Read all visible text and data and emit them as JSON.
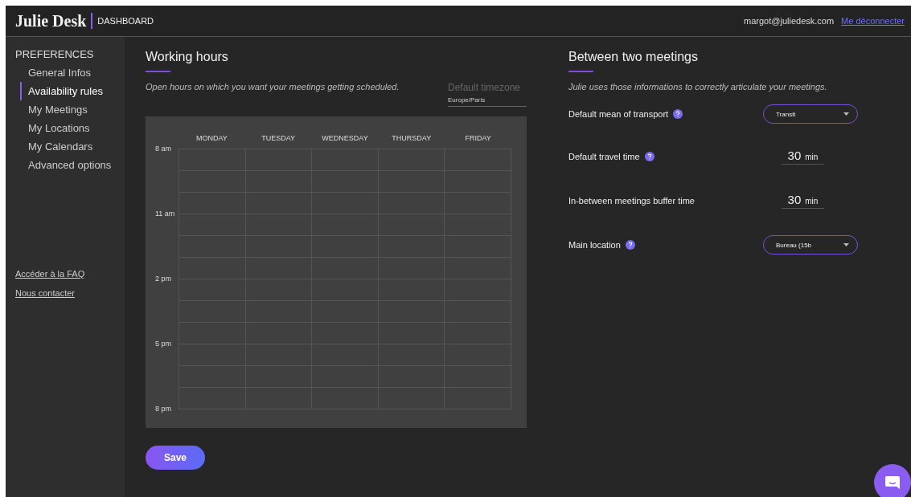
{
  "header": {
    "logo": "Julie Desk",
    "section": "DASHBOARD",
    "email": "margot@juliedesk.com",
    "logout": "Me déconnecter"
  },
  "sidebar": {
    "title": "PREFERENCES",
    "items": [
      {
        "label": "General Infos",
        "selected": false
      },
      {
        "label": "Availability rules",
        "selected": true
      },
      {
        "label": "My Meetings",
        "selected": false
      },
      {
        "label": "My Locations",
        "selected": false
      },
      {
        "label": "My Calendars",
        "selected": false
      },
      {
        "label": "Advanced options",
        "selected": false
      }
    ],
    "links": [
      "Accéder à la FAQ",
      "Nous contacter"
    ]
  },
  "working_hours": {
    "title": "Working hours",
    "description": "Open hours on which you want your meetings getting scheduled.",
    "timezone": {
      "label": "Default timezone",
      "value": "Europe/Paris"
    },
    "days": [
      "MONDAY",
      "TUESDAY",
      "WEDNESDAY",
      "THURSDAY",
      "FRIDAY"
    ],
    "time_labels": [
      "8 am",
      "11 am",
      "2 pm",
      "5 pm",
      "8 pm"
    ],
    "save": "Save"
  },
  "between_meetings": {
    "title": "Between two meetings",
    "description": "Julie uses those informations to correctly articulate your meetings.",
    "settings": [
      {
        "kind": "select",
        "label": "Default mean of transport",
        "help": true,
        "value": "Transit"
      },
      {
        "kind": "number",
        "label": "Default travel time",
        "help": true,
        "value": "30",
        "unit": "min"
      },
      {
        "kind": "number",
        "label": "In-between meetings buffer time",
        "help": false,
        "value": "30",
        "unit": "min"
      },
      {
        "kind": "select",
        "label": "Main location",
        "help": true,
        "value": "Bureau (15b"
      }
    ]
  }
}
